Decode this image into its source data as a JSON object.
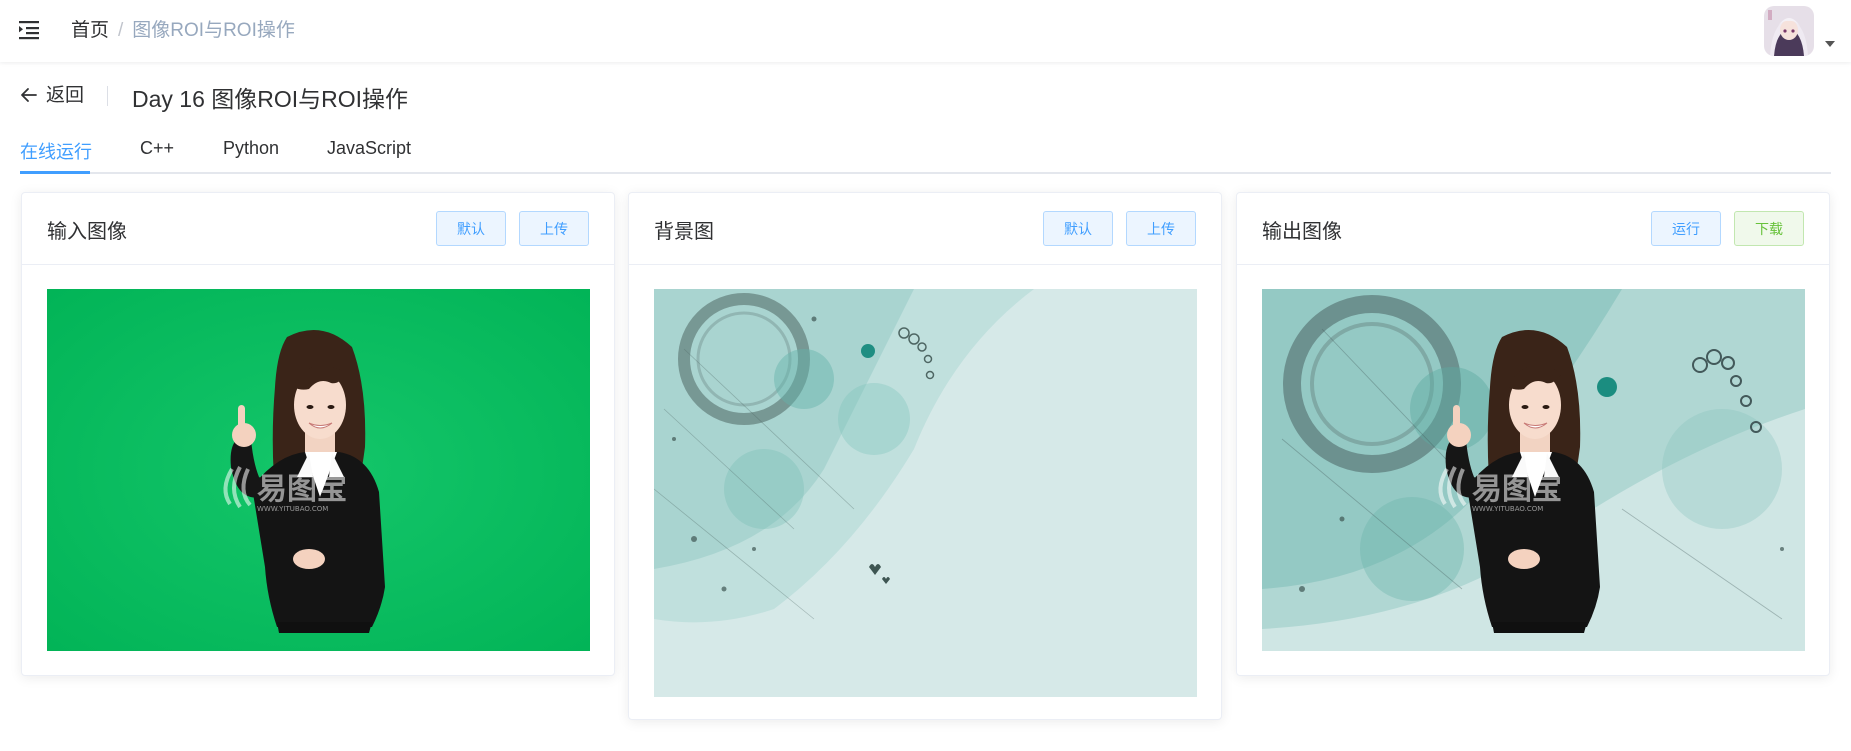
{
  "header": {
    "breadcrumb": {
      "home": "首页",
      "separator": "/",
      "current": "图像ROI与ROI操作"
    }
  },
  "page_header": {
    "back_label": "返回",
    "title": "Day 16 图像ROI与ROI操作"
  },
  "tabs": [
    {
      "label": "在线运行",
      "active": true
    },
    {
      "label": "C++",
      "active": false
    },
    {
      "label": "Python",
      "active": false
    },
    {
      "label": "JavaScript",
      "active": false
    }
  ],
  "cards": [
    {
      "title": "输入图像",
      "buttons": [
        "默认",
        "上传"
      ],
      "image_watermark": "易图宝",
      "image_watermark_url": "WWW.YITUBAO.COM"
    },
    {
      "title": "背景图",
      "buttons": [
        "默认",
        "上传"
      ]
    },
    {
      "title": "输出图像",
      "buttons": [
        "运行",
        "下载"
      ],
      "image_watermark": "易图宝",
      "image_watermark_url": "WWW.YITUBAO.COM"
    }
  ],
  "colors": {
    "accent": "#409eff",
    "success": "#67c23a",
    "green_screen": "#05b85a",
    "teal_background": "#d6e9e8"
  },
  "icons": {
    "menu": "hamburger-icon",
    "back": "arrow-left-icon",
    "dropdown": "caret-down-icon"
  }
}
